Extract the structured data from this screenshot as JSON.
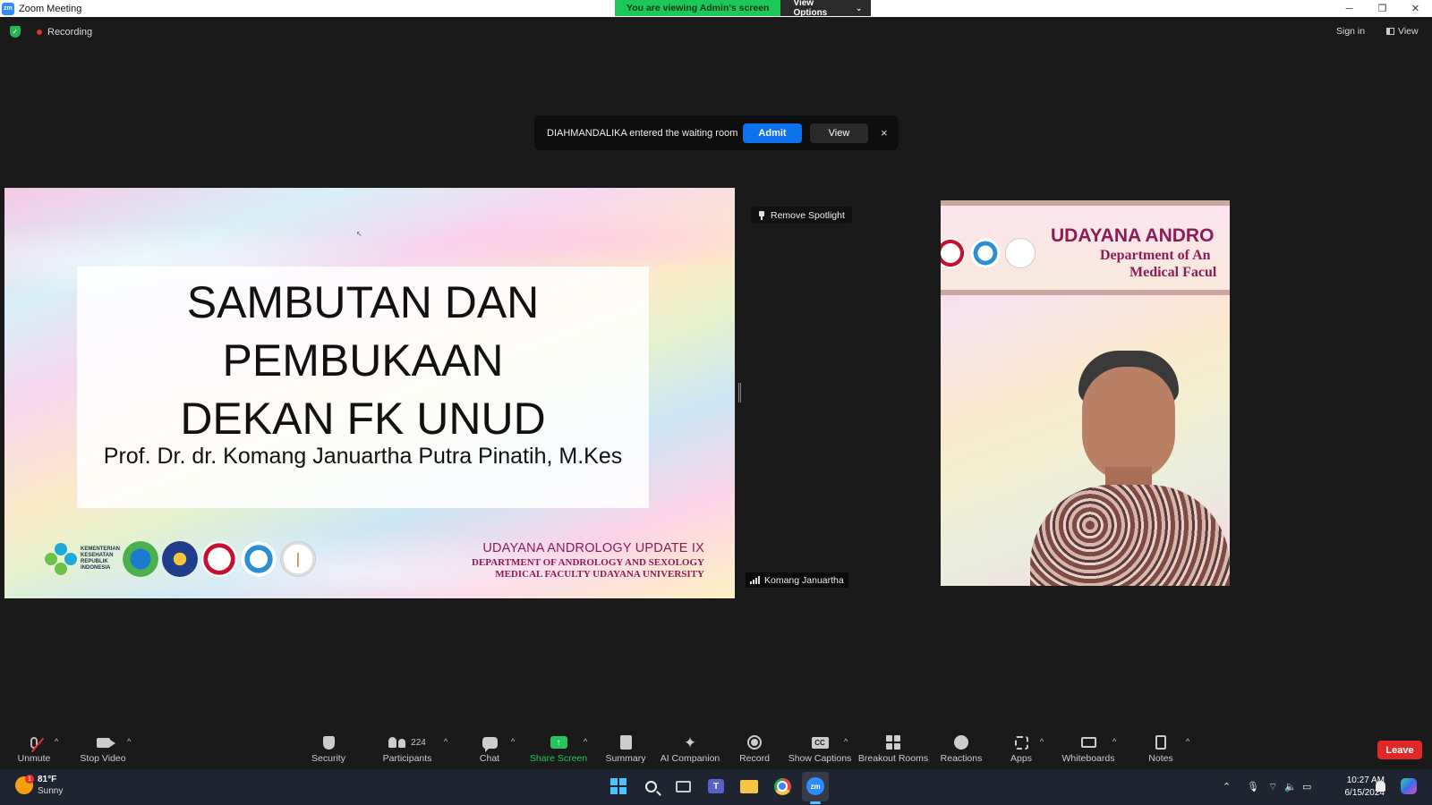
{
  "window": {
    "app_logo": "zm",
    "title": "Zoom Meeting",
    "viewing_banner": "You are viewing Admin's screen",
    "view_options": "View Options",
    "controls": [
      "minimize-icon",
      "restore-icon",
      "close-icon"
    ]
  },
  "top_bar": {
    "recording_label": "Recording",
    "sign_in": "Sign in",
    "view": "View"
  },
  "waiting_room": {
    "message": "DIAHMANDALIKA entered the waiting room",
    "admit": "Admit",
    "view": "View",
    "close": "×"
  },
  "slide": {
    "headline_lines": [
      "SAMBUTAN DAN",
      "PEMBUKAAN",
      "DEKAN FK UNUD"
    ],
    "speaker": "Prof. Dr. dr. Komang Januartha Putra Pinatih, M.Kes",
    "kemkes_logo_text": "KEMENTERIAN KESEHATAN REPUBLIK INDONESIA",
    "event_line1": "UDAYANA ANDROLOGY UPDATE IX",
    "event_line2": "DEPARTMENT OF ANDROLOGY AND SEXOLOGY",
    "event_line3": "MEDICAL FACULTY UDAYANA UNIVERSITY"
  },
  "spotlight": {
    "remove_label": "Remove Spotlight"
  },
  "video": {
    "banner_line1": "UDAYANA ANDRO",
    "banner_line2": "Department of An",
    "banner_line3": "Medical Facul",
    "participant_name": "Komang Januartha"
  },
  "toolbar": {
    "unmute": "Unmute",
    "stop_video": "Stop Video",
    "security": "Security",
    "participants": "Participants",
    "participants_count": "224",
    "chat": "Chat",
    "share_screen": "Share Screen",
    "summary": "Summary",
    "ai_companion": "AI Companion",
    "record": "Record",
    "show_captions": "Show Captions",
    "breakout_rooms": "Breakout Rooms",
    "reactions": "Reactions",
    "apps": "Apps",
    "whiteboards": "Whiteboards",
    "notes": "Notes",
    "leave": "Leave",
    "share_color": "#22c55e",
    "leave_color": "#e02828"
  },
  "taskbar": {
    "weather_badge": "1",
    "temperature": "81°F",
    "condition": "Sunny",
    "time": "10:27 AM",
    "date": "6/15/2024",
    "teams_glyph": "T",
    "zoom_glyph": "zm"
  }
}
